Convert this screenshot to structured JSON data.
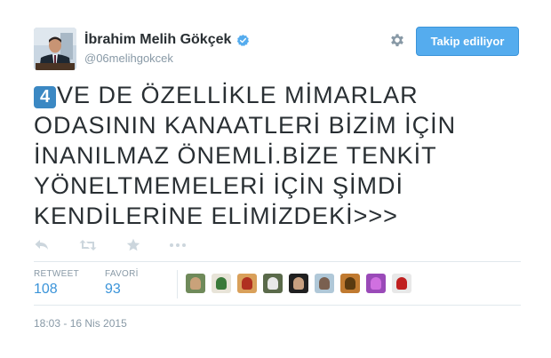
{
  "user": {
    "name": "İbrahim Melih Gökçek",
    "handle": "@06melihgokcek"
  },
  "follow_button": {
    "label": "Takip ediliyor"
  },
  "tweet": {
    "keycap": "4",
    "lines": [
      "VE DE ÖZELLİKLE MİMARLAR",
      "ODASININ KANAATLERİ BİZİM İÇİN",
      "İNANILMAZ ÖNEMLİ.BİZE TENKİT",
      "YÖNELTMEMELERİ İÇİN ŞİMDİ",
      "KENDİLERİNE ELİMİZDEKİ>>>"
    ]
  },
  "actions": [
    {
      "name": "reply-icon"
    },
    {
      "name": "retweet-icon"
    },
    {
      "name": "favorite-icon"
    },
    {
      "name": "more-icon"
    }
  ],
  "stats": {
    "retweet_label": "RETWEET",
    "retweet_count": "108",
    "favorite_label": "FAVORİ",
    "favorite_count": "93"
  },
  "favoriters": [
    {
      "name": "favoriter-avatar-1",
      "bg": "#6f8a5a",
      "fg": "#c9a27a"
    },
    {
      "name": "favoriter-avatar-2",
      "bg": "#e8e4d8",
      "fg": "#3a7a3a"
    },
    {
      "name": "favoriter-avatar-3",
      "bg": "#d9a05a",
      "fg": "#b03020"
    },
    {
      "name": "favoriter-avatar-4",
      "bg": "#5a6a4a",
      "fg": "#e8e8e8"
    },
    {
      "name": "favoriter-avatar-5",
      "bg": "#202020",
      "fg": "#c8a080"
    },
    {
      "name": "favoriter-avatar-6",
      "bg": "#b0c8d8",
      "fg": "#7a6050"
    },
    {
      "name": "favoriter-avatar-7",
      "bg": "#c07a30",
      "fg": "#5a3a10"
    },
    {
      "name": "favoriter-avatar-8",
      "bg": "#9a4ab8",
      "fg": "#d070e0"
    },
    {
      "name": "favoriter-avatar-9",
      "bg": "#e8e8e8",
      "fg": "#c02020"
    }
  ],
  "timestamp": "18:03 - 16 Nis 2015",
  "colors": {
    "accent": "#55acee",
    "link": "#3b94d9",
    "muted": "#8899a6",
    "keycap": "#3b88c3"
  }
}
